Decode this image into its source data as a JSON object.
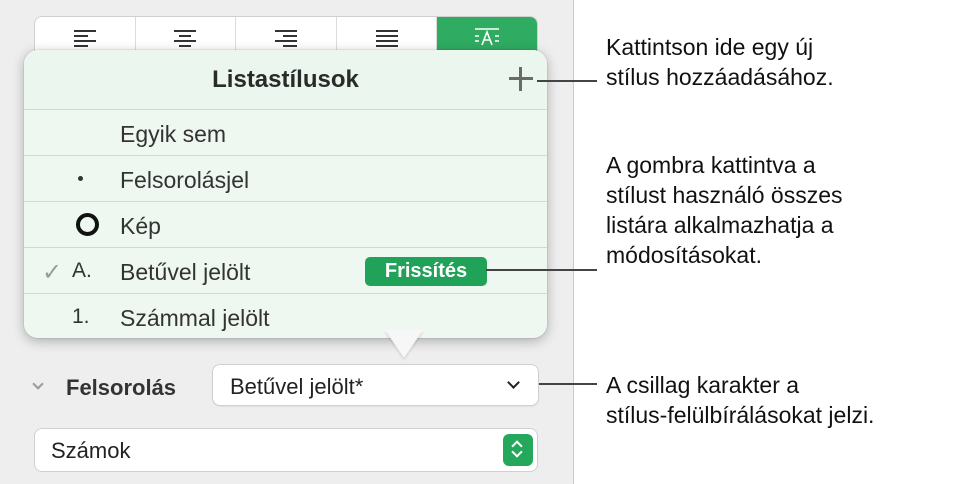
{
  "align_bar": {
    "buttons": [
      {
        "icon": "align-left-icon"
      },
      {
        "icon": "align-center-icon"
      },
      {
        "icon": "align-right-icon"
      },
      {
        "icon": "align-justify-icon"
      },
      {
        "icon": "text-fit-icon",
        "selected": true
      }
    ]
  },
  "popover": {
    "title": "Listastílusok",
    "add_icon": "plus-icon",
    "rows": [
      {
        "check": "",
        "marker": "",
        "label": "Egyik sem"
      },
      {
        "check": "",
        "marker": "bullet-dot",
        "label": "Felsorolásjel"
      },
      {
        "check": "",
        "marker": "ring-icon",
        "label": "Kép"
      },
      {
        "check": "✓",
        "marker": "A.",
        "label": "Betűvel jelölt",
        "button": "Frissítés"
      },
      {
        "check": "",
        "marker": "1.",
        "label": "Számmal jelölt"
      }
    ]
  },
  "bullets": {
    "label": "Felsorolás",
    "style_value": "Betűvel jelölt*"
  },
  "numbers": {
    "value": "Számok"
  },
  "callouts": {
    "add_style": "Kattintson ide egy új\nstílus hozzáadásához.",
    "update": "A gombra kattintva a\nstílust használó összes\nlistára alkalmazhatja a\nmódosításokat.",
    "override": "A csillag karakter a\nstílus-felülbírálásokat jelzi."
  },
  "colors": {
    "accent_green": "#20a358",
    "header_tint": "#eaf6ee",
    "panel_bg": "#eeeeee"
  }
}
